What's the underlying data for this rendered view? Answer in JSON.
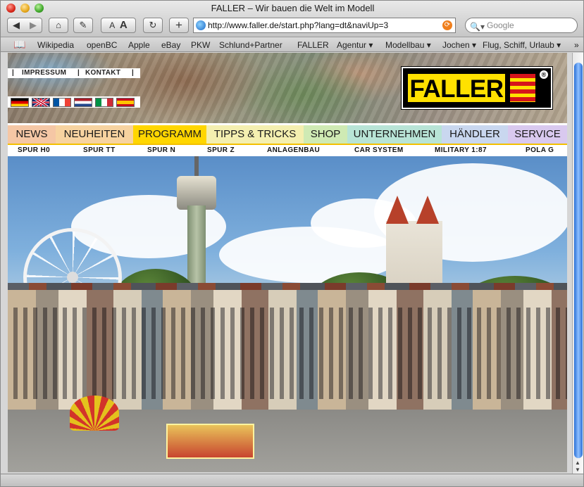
{
  "window": {
    "title": "FALLER – Wir bauen die Welt im Modell"
  },
  "toolbar": {
    "back_icon": "arrow-left",
    "forward_icon": "arrow-right",
    "home_icon": "house",
    "edit_icon": "pencil",
    "font_small": "A",
    "font_large": "A",
    "reload_icon": "↻",
    "add_icon": "+",
    "url": "http://www.faller.de/start.php?lang=dt&naviUp=3",
    "rss_icon": "⟳",
    "search_placeholder": "Google"
  },
  "bookmarks": [
    "Wikipedia",
    "openBC",
    "Apple",
    "eBay",
    "PKW",
    "Schlund+Partner",
    "FALLER",
    "Agentur ▾",
    "Modellbau ▾",
    "Jochen ▾",
    "Flug, Schiff, Urlaub ▾",
    "»"
  ],
  "site": {
    "top_links": [
      "IMPRESSUM",
      "KONTAKT"
    ],
    "logo": "FALLER",
    "logo_mark": "®",
    "nav": [
      "NEWS",
      "NEUHEITEN",
      "PROGRAMM",
      "TIPPS & TRICKS",
      "SHOP",
      "UNTERNEHMEN",
      "HÄNDLER",
      "SERVICE"
    ],
    "nav_active": "PROGRAMM",
    "subnav": [
      "SPUR H0",
      "SPUR TT",
      "SPUR N",
      "SPUR Z",
      "ANLAGENBAU",
      "CAR SYSTEM",
      "MILITARY 1:87",
      "POLA G"
    ],
    "nav_colors": [
      "#f5c7a5",
      "#f7d3a0",
      "#ffd600",
      "#f4efb0",
      "#cfeab4",
      "#b8e4d6",
      "#c9d7ef",
      "#d9c9ef"
    ]
  }
}
